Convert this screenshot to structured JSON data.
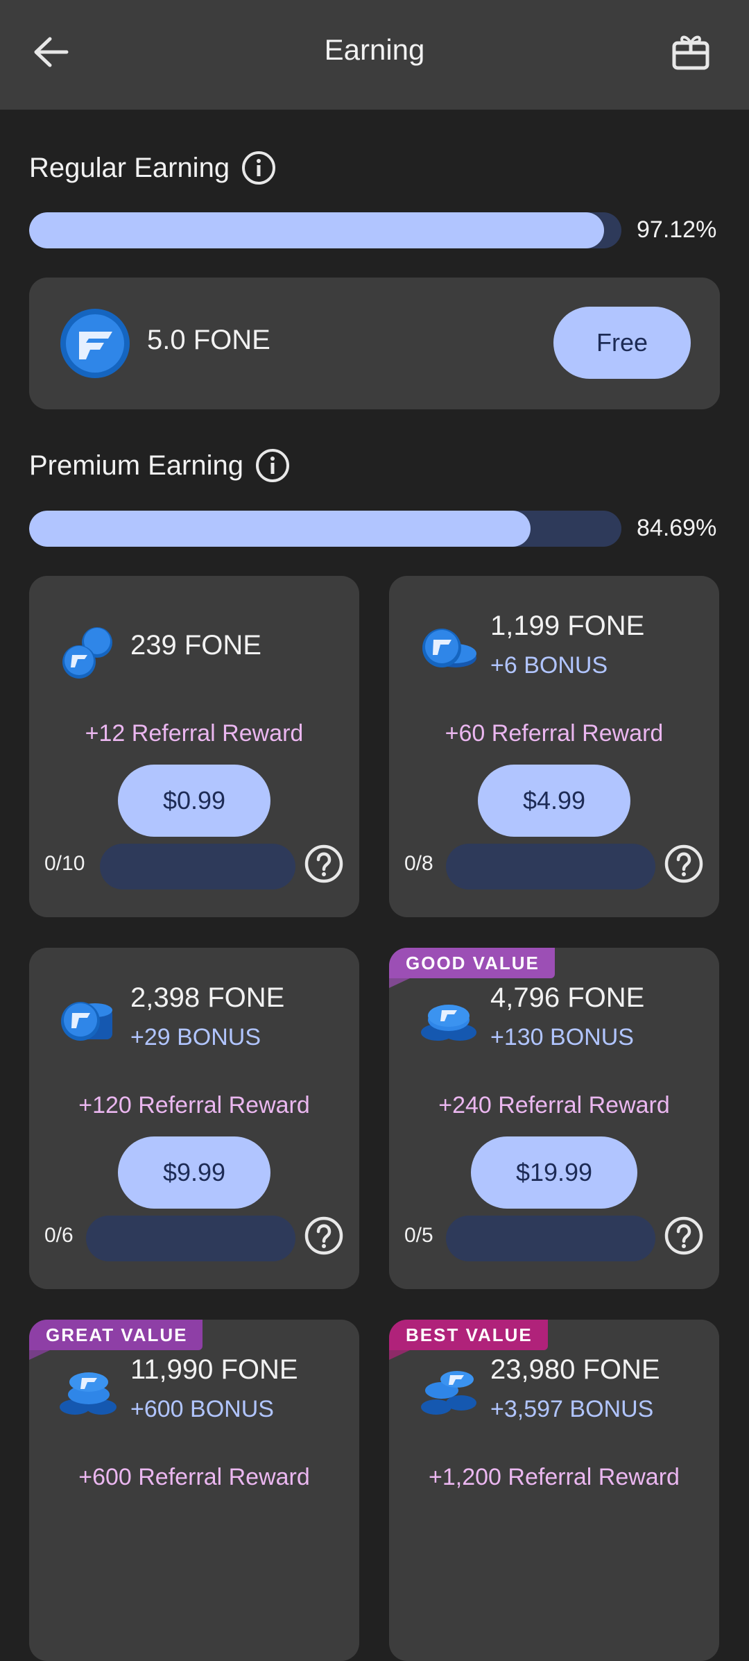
{
  "header": {
    "title": "Earning",
    "back_icon": "arrow-left-icon",
    "gift_icon": "gift-icon"
  },
  "regular": {
    "title": "Regular Earning",
    "progress_percent": 97.12,
    "progress_label": "97.12%",
    "amount": "5.0 FONE",
    "button": "Free"
  },
  "premium": {
    "title": "Premium Earning",
    "progress_percent": 84.69,
    "progress_label": "84.69%",
    "cards": [
      {
        "fone": "239 FONE",
        "bonus": "",
        "referral": "+12 Referral Reward",
        "price": "$0.99",
        "count": "0/10",
        "ribbon": ""
      },
      {
        "fone": "1,199 FONE",
        "bonus": "+6 BONUS",
        "referral": "+60 Referral Reward",
        "price": "$4.99",
        "count": "0/8",
        "ribbon": ""
      },
      {
        "fone": "2,398 FONE",
        "bonus": "+29 BONUS",
        "referral": "+120 Referral Reward",
        "price": "$9.99",
        "count": "0/6",
        "ribbon": ""
      },
      {
        "fone": "4,796 FONE",
        "bonus": "+130 BONUS",
        "referral": "+240 Referral Reward",
        "price": "$19.99",
        "count": "0/5",
        "ribbon": "GOOD VALUE"
      },
      {
        "fone": "11,990 FONE",
        "bonus": "+600 BONUS",
        "referral": "+600 Referral Reward",
        "price": "",
        "count": "",
        "ribbon": "GREAT VALUE"
      },
      {
        "fone": "23,980 FONE",
        "bonus": "+3,597 BONUS",
        "referral": "+1,200 Referral Reward",
        "price": "",
        "count": "",
        "ribbon": "BEST VALUE"
      }
    ]
  },
  "colors": {
    "accent": "#b1c5ff",
    "referral": "#ebb7f0",
    "good_value": "#9c4fb5",
    "great_value": "#8e3fa6",
    "best_value": "#b0227a"
  }
}
